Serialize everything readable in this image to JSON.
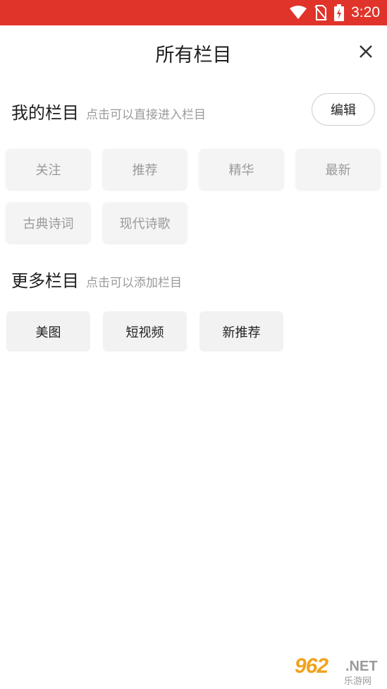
{
  "status_bar": {
    "time": "3:20",
    "bg_color": "#e0342a"
  },
  "header": {
    "title": "所有栏目"
  },
  "my_section": {
    "title": "我的栏目",
    "hint": "点击可以直接进入栏目",
    "edit_label": "编辑",
    "channels": [
      "关注",
      "推荐",
      "精华",
      "最新",
      "古典诗词",
      "现代诗歌"
    ]
  },
  "more_section": {
    "title": "更多栏目",
    "hint": "点击可以添加栏目",
    "channels": [
      "美图",
      "短视频",
      "新推荐"
    ]
  },
  "watermark": {
    "number": "962",
    "suffix": ".NET",
    "sub": "乐游网"
  }
}
